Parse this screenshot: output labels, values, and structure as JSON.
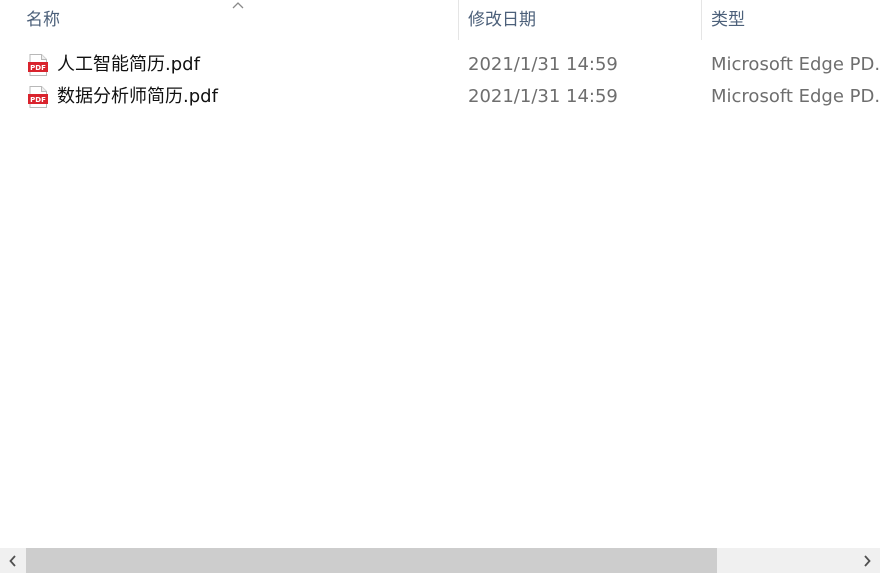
{
  "columns": {
    "name": "名称",
    "date": "修改日期",
    "type": "类型"
  },
  "sort": {
    "column": "name",
    "direction": "ascending",
    "icon": "chevron-up-icon"
  },
  "files": [
    {
      "name": "人工智能简历.pdf",
      "date": "2021/1/31 14:59",
      "type": "Microsoft Edge PD..",
      "icon": "pdf-file-icon",
      "icon_label": "PDF"
    },
    {
      "name": "数据分析师简历.pdf",
      "date": "2021/1/31 14:59",
      "type": "Microsoft Edge PD..",
      "icon": "pdf-file-icon",
      "icon_label": "PDF"
    }
  ],
  "scrollbar": {
    "left_icon": "chevron-left-icon",
    "right_icon": "chevron-right-icon",
    "position": 0,
    "visible_fraction": 0.83
  },
  "colors": {
    "header_text": "#4c607a",
    "file_name_text": "#111111",
    "secondary_text": "#6e6e6e",
    "pdf_icon_red": "#d9232d",
    "scroll_track": "#f0f0f0",
    "scroll_thumb": "#cdcdcd"
  }
}
